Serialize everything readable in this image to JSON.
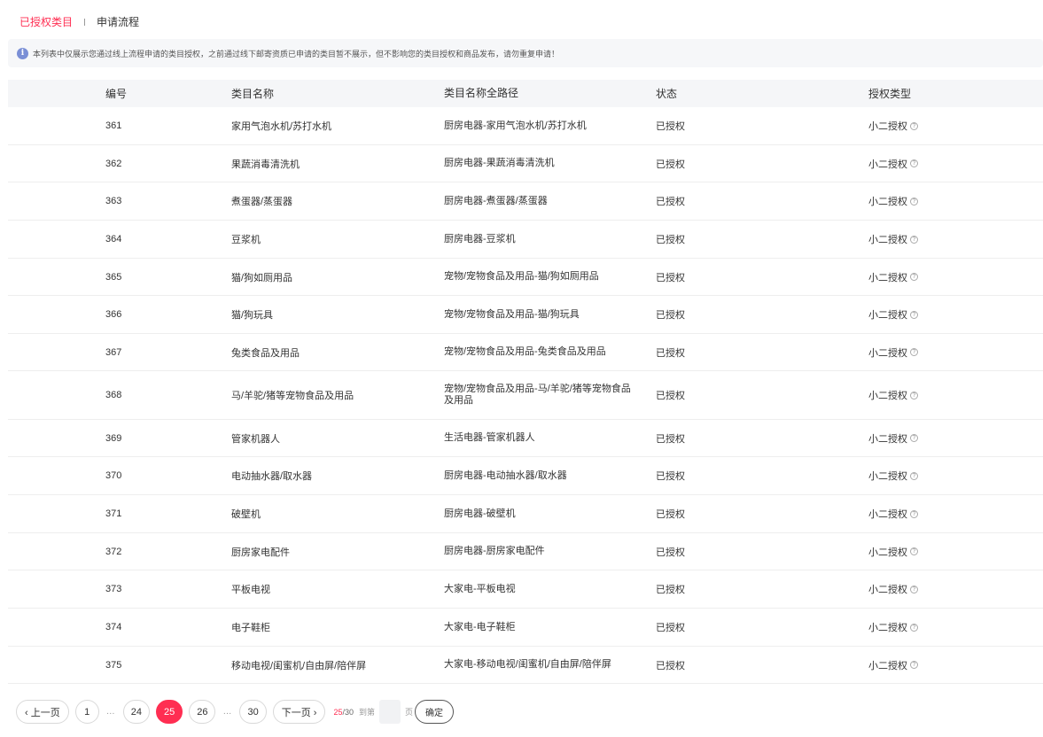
{
  "tabs": [
    {
      "label": "已授权类目",
      "active": true
    },
    {
      "label": "申请流程",
      "active": false
    }
  ],
  "notice": {
    "icon": "info-icon",
    "text": "本列表中仅展示您通过线上流程申请的类目授权，之前通过线下邮寄资质已申请的类目暂不展示，但不影响您的类目授权和商品发布，请勿重复申请！"
  },
  "table": {
    "headers": {
      "id": "编号",
      "name": "类目名称",
      "path": "类目名称全路径",
      "status": "状态",
      "type": "授权类型"
    },
    "rows": [
      {
        "id": "361",
        "name": "家用气泡水机/苏打水机",
        "path": "厨房电器-家用气泡水机/苏打水机",
        "status": "已授权",
        "type": "小二授权"
      },
      {
        "id": "362",
        "name": "果蔬消毒清洗机",
        "path": "厨房电器-果蔬消毒清洗机",
        "status": "已授权",
        "type": "小二授权"
      },
      {
        "id": "363",
        "name": "煮蛋器/蒸蛋器",
        "path": "厨房电器-煮蛋器/蒸蛋器",
        "status": "已授权",
        "type": "小二授权"
      },
      {
        "id": "364",
        "name": "豆浆机",
        "path": "厨房电器-豆浆机",
        "status": "已授权",
        "type": "小二授权"
      },
      {
        "id": "365",
        "name": "猫/狗如厕用品",
        "path": "宠物/宠物食品及用品-猫/狗如厕用品",
        "status": "已授权",
        "type": "小二授权"
      },
      {
        "id": "366",
        "name": "猫/狗玩具",
        "path": "宠物/宠物食品及用品-猫/狗玩具",
        "status": "已授权",
        "type": "小二授权"
      },
      {
        "id": "367",
        "name": "兔类食品及用品",
        "path": "宠物/宠物食品及用品-兔类食品及用品",
        "status": "已授权",
        "type": "小二授权"
      },
      {
        "id": "368",
        "name": "马/羊驼/猪等宠物食品及用品",
        "path": "宠物/宠物食品及用品-马/羊驼/猪等宠物食品及用品",
        "status": "已授权",
        "type": "小二授权"
      },
      {
        "id": "369",
        "name": "管家机器人",
        "path": "生活电器-管家机器人",
        "status": "已授权",
        "type": "小二授权"
      },
      {
        "id": "370",
        "name": "电动抽水器/取水器",
        "path": "厨房电器-电动抽水器/取水器",
        "status": "已授权",
        "type": "小二授权"
      },
      {
        "id": "371",
        "name": "破壁机",
        "path": "厨房电器-破壁机",
        "status": "已授权",
        "type": "小二授权"
      },
      {
        "id": "372",
        "name": "厨房家电配件",
        "path": "厨房电器-厨房家电配件",
        "status": "已授权",
        "type": "小二授权"
      },
      {
        "id": "373",
        "name": "平板电视",
        "path": "大家电-平板电视",
        "status": "已授权",
        "type": "小二授权"
      },
      {
        "id": "374",
        "name": "电子鞋柜",
        "path": "大家电-电子鞋柜",
        "status": "已授权",
        "type": "小二授权"
      },
      {
        "id": "375",
        "name": "移动电视/闺蜜机/自由屏/陪伴屏",
        "path": "大家电-移动电视/闺蜜机/自由屏/陪伴屏",
        "status": "已授权",
        "type": "小二授权"
      }
    ]
  },
  "pagination": {
    "prev_label": "‹ 上一页",
    "next_label": "下一页 ›",
    "pages": [
      "1",
      "…",
      "24",
      "25",
      "26",
      "…",
      "30"
    ],
    "current": "25",
    "current_display": "25",
    "total_display": "/30",
    "jump_prefix": "到第",
    "jump_suffix": "页",
    "jump_value": "",
    "confirm_label": "确定"
  },
  "colors": {
    "accent": "#ff2e52",
    "header_bg": "#f5f6f8",
    "notice_bg": "#f6f7f9",
    "info_icon": "#7a8fd6"
  }
}
